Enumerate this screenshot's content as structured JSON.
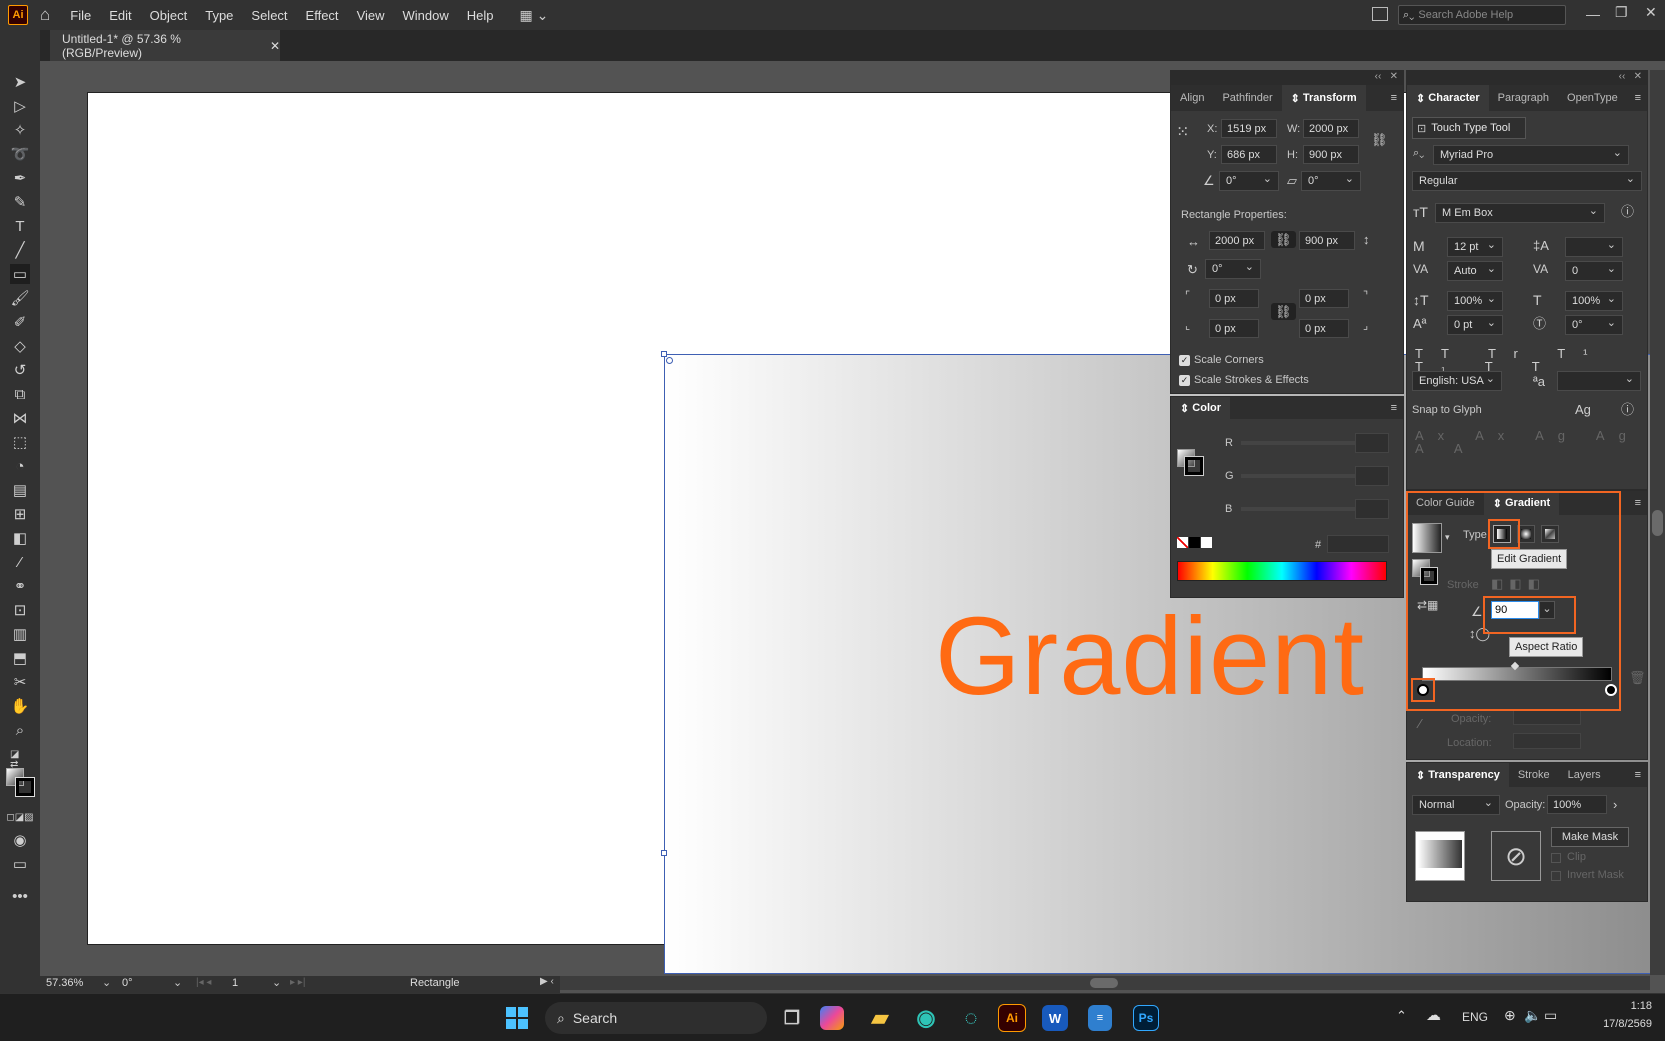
{
  "app": {
    "logo": "Ai",
    "search_placeholder": "Search Adobe Help"
  },
  "menu": [
    "File",
    "Edit",
    "Object",
    "Type",
    "Select",
    "Effect",
    "View",
    "Window",
    "Help"
  ],
  "document": {
    "tab_title": "Untitled-1* @ 57.36 % (RGB/Preview)"
  },
  "canvas": {
    "text": "Gradient",
    "text_color": "#ff6a13"
  },
  "transform_panel": {
    "tabs": [
      "Align",
      "Pathfinder",
      "Transform"
    ],
    "x_label": "X:",
    "x": "1519 px",
    "y_label": "Y:",
    "y": "686 px",
    "w_label": "W:",
    "w": "2000 px",
    "h_label": "H:",
    "h": "900 px",
    "rotate": "0°",
    "shear": "0°",
    "rect_props_label": "Rectangle Properties:",
    "rect_w": "2000 px",
    "rect_h": "900 px",
    "rect_rotate": "0°",
    "corner_tl": "0 px",
    "corner_tr": "0 px",
    "corner_bl": "0 px",
    "corner_br": "0 px",
    "scale_corners": "Scale Corners",
    "scale_strokes": "Scale Strokes & Effects"
  },
  "color_panel": {
    "title": "Color",
    "r": "R",
    "g": "G",
    "b": "B",
    "hash": "#"
  },
  "character_panel": {
    "tabs": [
      "Character",
      "Paragraph",
      "OpenType"
    ],
    "touch_type": "Touch Type Tool",
    "font_family": "Myriad Pro",
    "font_style": "Regular",
    "em_box": "Em Box",
    "size": "12 pt",
    "leading": "",
    "kerning": "Auto",
    "tracking": "0",
    "vscale": "100%",
    "hscale": "100%",
    "baseline": "0 pt",
    "rotation": "0°",
    "language": "English: USA",
    "snap": "Snap to Glyph"
  },
  "gradient_panel": {
    "tabs": [
      "Color Guide",
      "Gradient"
    ],
    "type_label": "Type",
    "edit_gradient_tip": "Edit Gradient",
    "stroke_label": "Stroke",
    "angle_value": "90",
    "aspect_tip": "Aspect Ratio",
    "opacity_label": "Opacity:",
    "location_label": "Location:"
  },
  "transparency_panel": {
    "tabs": [
      "Transparency",
      "Stroke",
      "Layers"
    ],
    "blend_mode": "Normal",
    "opacity_label": "Opacity:",
    "opacity": "100%",
    "make_mask": "Make Mask",
    "clip": "Clip",
    "invert_mask": "Invert Mask"
  },
  "status_bar": {
    "zoom": "57.36%",
    "rotation": "0°",
    "artboard": "1",
    "tool_label": "Rectangle"
  },
  "taskbar": {
    "search": "Search",
    "lang": "ENG",
    "time": "1:18",
    "date": "17/8/2569"
  }
}
